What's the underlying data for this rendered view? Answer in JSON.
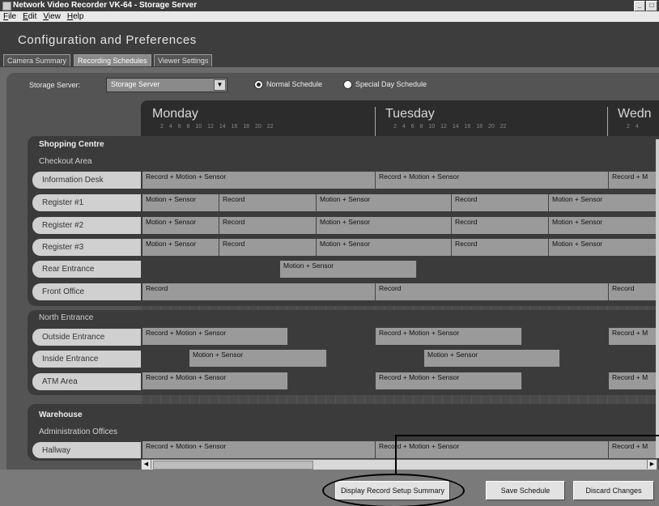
{
  "window": {
    "title": "Network Video Recorder VK-64 - Storage Server",
    "buttons": [
      "_",
      "□"
    ]
  },
  "menu": [
    "File",
    "Edit",
    "View",
    "Help"
  ],
  "header": {
    "title": "Configuration and Preferences"
  },
  "tabs": [
    "Camera Summary",
    "Recording Schedules",
    "Viewer Settings"
  ],
  "active_tab": "Recording Schedules",
  "storage": {
    "label": "Storage Server:",
    "value": "Storage Server"
  },
  "radios": [
    {
      "label": "Normal Schedule",
      "selected": true
    },
    {
      "label": "Special Day Schedule",
      "selected": false
    }
  ],
  "days": [
    "Monday",
    "Tuesday",
    "Wedn"
  ],
  "hours": "2 4 6 8 10 12 14 16 18 20 22",
  "hours_short": "2 4",
  "groups": [
    {
      "title": "Shopping Centre",
      "sub": "Checkout Area"
    },
    {
      "title": "",
      "sub": "North Entrance"
    },
    {
      "title": "Warehouse",
      "sub": "Administration Offices"
    }
  ],
  "rows": [
    {
      "label": "Information Desk",
      "bands": [
        "Record + Motion + Sensor",
        "Record + Motion + Sensor",
        "Record + M"
      ]
    },
    {
      "label": "Register #1",
      "bands": [
        "Motion + Sensor",
        "Record",
        "Motion + Sensor",
        "Record",
        "Motion + Sensor"
      ]
    },
    {
      "label": "Register #2",
      "bands": [
        "Motion + Sensor",
        "Record",
        "Motion + Sensor",
        "Record",
        "Motion + Sensor"
      ]
    },
    {
      "label": "Register #3",
      "bands": [
        "Motion + Sensor",
        "Record",
        "Motion + Sensor",
        "Record",
        "Motion + Sensor"
      ]
    },
    {
      "label": "Rear Entrance",
      "bands": [
        "Motion + Sensor"
      ]
    },
    {
      "label": "Front Office",
      "bands": [
        "Record",
        "Record",
        "Record"
      ]
    },
    {
      "label": "Outside Entrance",
      "bands": [
        "Record + Motion + Sensor",
        "Record + Motion + Sensor",
        "Record + M"
      ]
    },
    {
      "label": "Inside Entrance",
      "bands": [
        "Motion + Sensor",
        "Motion + Sensor"
      ]
    },
    {
      "label": "ATM Area",
      "bands": [
        "Record + Motion + Sensor",
        "Record + Motion + Sensor",
        "Record + M"
      ]
    },
    {
      "label": "Hallway",
      "bands": [
        "Record + Motion + Sensor",
        "Record + Motion + Sensor",
        "Record + M"
      ]
    }
  ],
  "buttons": {
    "summary": "Display Record Setup Summary",
    "save": "Save Schedule",
    "discard": "Discard Changes"
  },
  "scroll": {
    "left_arrow": "◀",
    "right_arrow": "▶"
  },
  "colors": {
    "band": "#9a9a9a",
    "label_bg": "#d0d0d0",
    "panel": "#545454",
    "header": "#3d3d3d"
  }
}
